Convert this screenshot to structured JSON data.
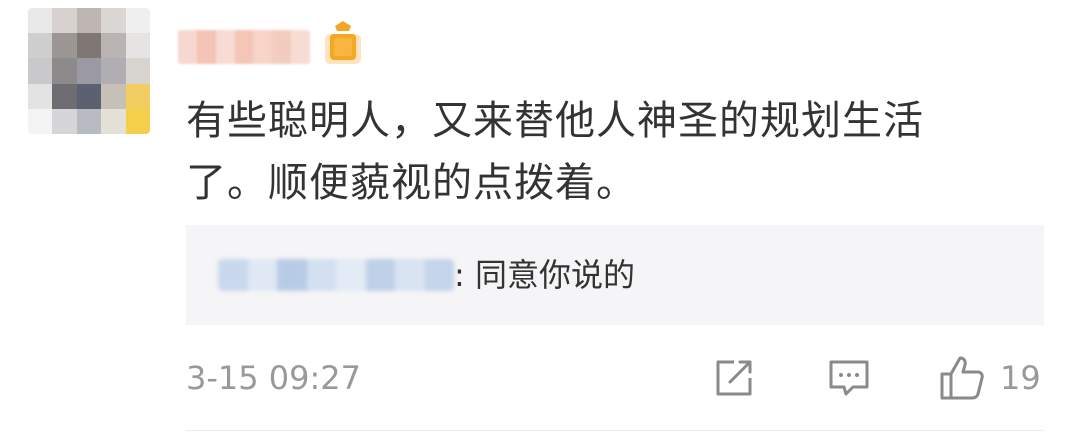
{
  "comment": {
    "username": "",
    "text_line1": "有些聪明人，又来替他人神圣的规划生活",
    "text_line2": "了。顺便藐视的点拨着。"
  },
  "reply": {
    "author": "",
    "separator": ":",
    "text": " 同意你说的"
  },
  "meta": {
    "timestamp": "3-15 09:27",
    "like_count": "19"
  },
  "icons": {
    "avatar": "avatar-image",
    "vip": "vip-badge-icon",
    "share": "share-icon",
    "comment": "comment-icon",
    "like": "thumbs-up-icon"
  },
  "colors": {
    "text": "#333333",
    "secondary": "#999999",
    "reply_background": "#f5f5f7",
    "icon": "#8a8a8a",
    "vip_badge": "#f5a623"
  }
}
